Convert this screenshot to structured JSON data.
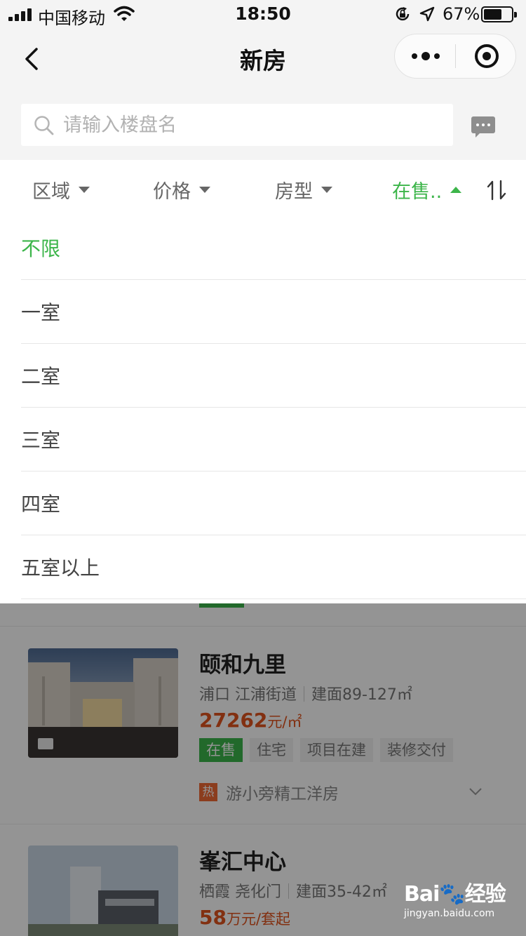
{
  "status_bar": {
    "carrier": "中国移动",
    "time": "18:50",
    "battery_text": "67%",
    "battery_level": 0.67,
    "icons": [
      "signal-icon",
      "wifi-icon",
      "orientation-lock-icon",
      "location-icon",
      "battery-icon"
    ]
  },
  "nav": {
    "title": "新房",
    "icons": [
      "back-icon",
      "more-icon",
      "close-miniprogram-icon"
    ]
  },
  "search": {
    "placeholder": "请输入楼盘名",
    "value": ""
  },
  "filters": {
    "tabs": [
      {
        "label": "区域",
        "active": false
      },
      {
        "label": "价格",
        "active": false
      },
      {
        "label": "房型",
        "active": false
      },
      {
        "label": "在售..",
        "active": true
      }
    ],
    "sort_icon": "sort-icon"
  },
  "dropdown": {
    "options": [
      {
        "label": "不限",
        "selected": true
      },
      {
        "label": "一室",
        "selected": false
      },
      {
        "label": "二室",
        "selected": false
      },
      {
        "label": "三室",
        "selected": false
      },
      {
        "label": "四室",
        "selected": false
      },
      {
        "label": "五室以上",
        "selected": false
      }
    ]
  },
  "listings": [
    {
      "name": "颐和九里",
      "district": "浦口 江浦街道",
      "area": "建面89-127㎡",
      "price_value": "27262",
      "price_unit": "元/㎡",
      "tags": [
        "在售",
        "住宅",
        "项目在建",
        "装修交付"
      ],
      "promo_badge": "热",
      "promo_text": "游小旁精工洋房"
    },
    {
      "name": "峯汇中心",
      "district": "栖霞 尧化门",
      "area": "建面35-42㎡",
      "price_value": "58",
      "price_unit": "万元/套起"
    }
  ],
  "watermark": {
    "brand_a": "Bai",
    "brand_b": "经验",
    "url": "jingyan.baidu.com"
  },
  "colors": {
    "accent_green": "#3cb54a",
    "price_orange": "#e0541e",
    "hot_badge": "#f06a35"
  }
}
